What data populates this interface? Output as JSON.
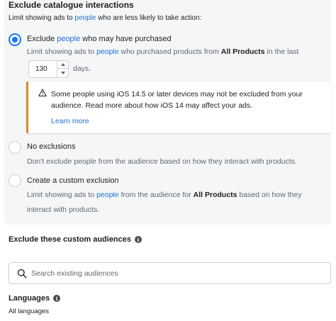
{
  "catalogue": {
    "title": "Exclude catalogue interactions",
    "subtitle_pre": "Limit showing ads to ",
    "subtitle_link": "people",
    "subtitle_post": " who are less likely to take action:"
  },
  "options": {
    "purchased": {
      "label_pre": "Exclude ",
      "label_link": "people",
      "label_post": " who may have purchased",
      "desc_pre": "Limit showing ads to ",
      "desc_link": "people",
      "desc_mid": " who purchased products from ",
      "desc_bold": "All Products",
      "desc_post": " in the last",
      "days_value": "130",
      "days_unit": "days.",
      "selected": true
    },
    "none": {
      "label": "No exclusions",
      "desc": "Don't exclude people from the audience based on how they interact with products.",
      "selected": false
    },
    "custom": {
      "label": "Create a custom exclusion",
      "desc_pre": "Limit showing ads to ",
      "desc_link": "people",
      "desc_mid": " from the audience for ",
      "desc_bold": "All Products",
      "desc_post": " based on how they",
      "desc_line2": "interact with products.",
      "selected": false
    }
  },
  "warning": {
    "icon": "warning-triangle-icon",
    "text": "Some people using iOS 14.5 or later devices may not be excluded from your audience. Read more about how iOS 14 may affect your ads.",
    "link": "Learn more"
  },
  "custom_audiences": {
    "title": "Exclude these custom audiences",
    "search_placeholder": "Search existing audiences"
  },
  "languages": {
    "title": "Languages",
    "value": "All languages"
  },
  "colors": {
    "accent": "#1877f2",
    "link": "#216fdb",
    "warning": "#d88b2c",
    "panel_bg": "#f5f6f7"
  }
}
